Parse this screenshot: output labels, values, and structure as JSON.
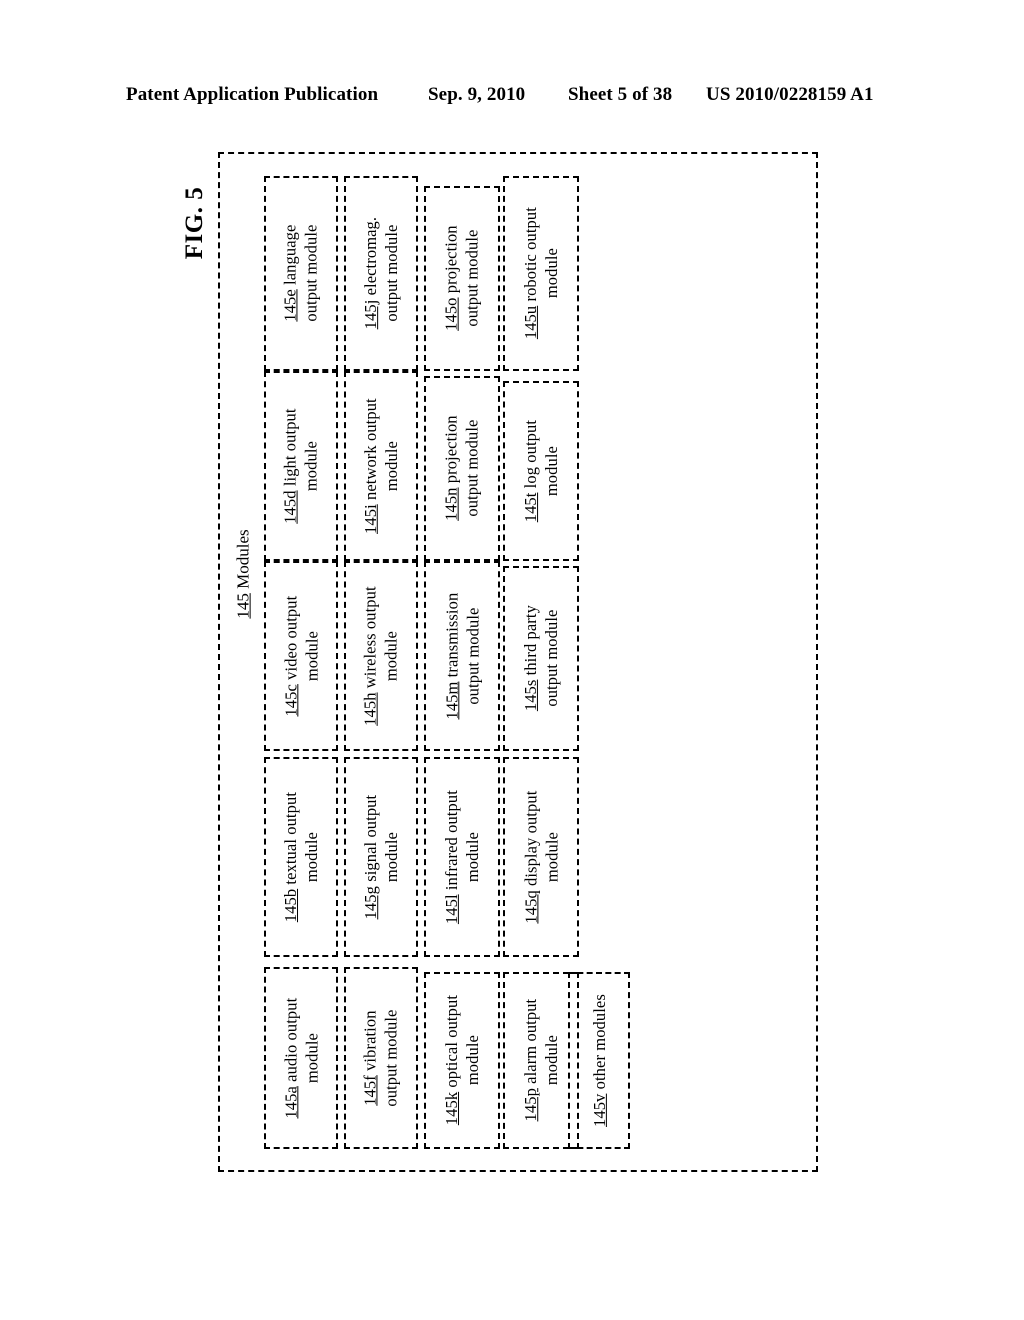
{
  "header": {
    "publication": "Patent Application Publication",
    "date": "Sep. 9, 2010",
    "sheet": "Sheet 5 of 38",
    "doc_number": "US 2010/0228159 A1"
  },
  "figure": {
    "label": "FIG. 5",
    "container": {
      "ref": "145",
      "title": "Modules",
      "caption": "145 Modules"
    }
  },
  "modules": {
    "columns": [
      {
        "name": "column-1",
        "boxes": [
          {
            "ref": "145e",
            "line1": "145e language",
            "line2": "output module",
            "text": "145e language output module"
          },
          {
            "ref": "145d",
            "line1": "145d light output",
            "line2": "module",
            "text": "145d light output module"
          },
          {
            "ref": "145c",
            "line1": "145c video output",
            "line2": "module",
            "text": "145c video output module"
          },
          {
            "ref": "145b",
            "line1": "145b textual output",
            "line2": "module",
            "text": "145b textual output module"
          },
          {
            "ref": "145a",
            "line1": "145a audio output",
            "line2": "module",
            "text": "145a audio output module"
          }
        ]
      },
      {
        "name": "column-2",
        "boxes": [
          {
            "ref": "145j",
            "line1": "145j electromag.",
            "line2": "output module",
            "text": "145j electromag. output module"
          },
          {
            "ref": "145i",
            "line1": "145i network output",
            "line2": "module",
            "text": "145i network output module"
          },
          {
            "ref": "145h",
            "line1": "145h wireless output",
            "line2": "module",
            "text": "145h wireless output module"
          },
          {
            "ref": "145g",
            "line1": "145g signal output",
            "line2": "module",
            "text": "145g signal output module"
          },
          {
            "ref": "145f",
            "line1": "145f vibration",
            "line2": "output module",
            "text": "145f vibration output module"
          }
        ]
      },
      {
        "name": "column-3",
        "boxes": [
          {
            "ref": "145o",
            "line1": "145o projection",
            "line2": "output module",
            "text": "145o projection output module"
          },
          {
            "ref": "145n",
            "line1": "145n projection",
            "line2": "output module",
            "text": "145n projection output module"
          },
          {
            "ref": "145m",
            "line1": "145m transmission",
            "line2": "output module",
            "text": "145m transmission output module"
          },
          {
            "ref": "145l",
            "line1": "145l infrared output",
            "line2": "module",
            "text": "145l infrared output module"
          },
          {
            "ref": "145k",
            "line1": "145k optical output",
            "line2": "module",
            "text": "145k optical output module"
          }
        ]
      },
      {
        "name": "column-4",
        "boxes": [
          {
            "ref": "145u",
            "line1": "145u robotic output",
            "line2": "module",
            "text": "145u robotic output module"
          },
          {
            "ref": "145t",
            "line1": "145t log output",
            "line2": "module",
            "text": "145t log output module"
          },
          {
            "ref": "145s",
            "line1": "145s third party",
            "line2": "output module",
            "text": "145s third party output module"
          },
          {
            "ref": "145q",
            "line1": "145q display output",
            "line2": "module",
            "text": "145q display output module"
          },
          {
            "ref": "145p",
            "line1": "145p alarm output",
            "line2": "module",
            "text": "145p alarm output module"
          }
        ]
      },
      {
        "name": "column-5",
        "boxes": [
          {
            "ref": "145v",
            "line1": "145v other modules",
            "line2": "",
            "text": "145v other modules"
          }
        ]
      }
    ]
  }
}
